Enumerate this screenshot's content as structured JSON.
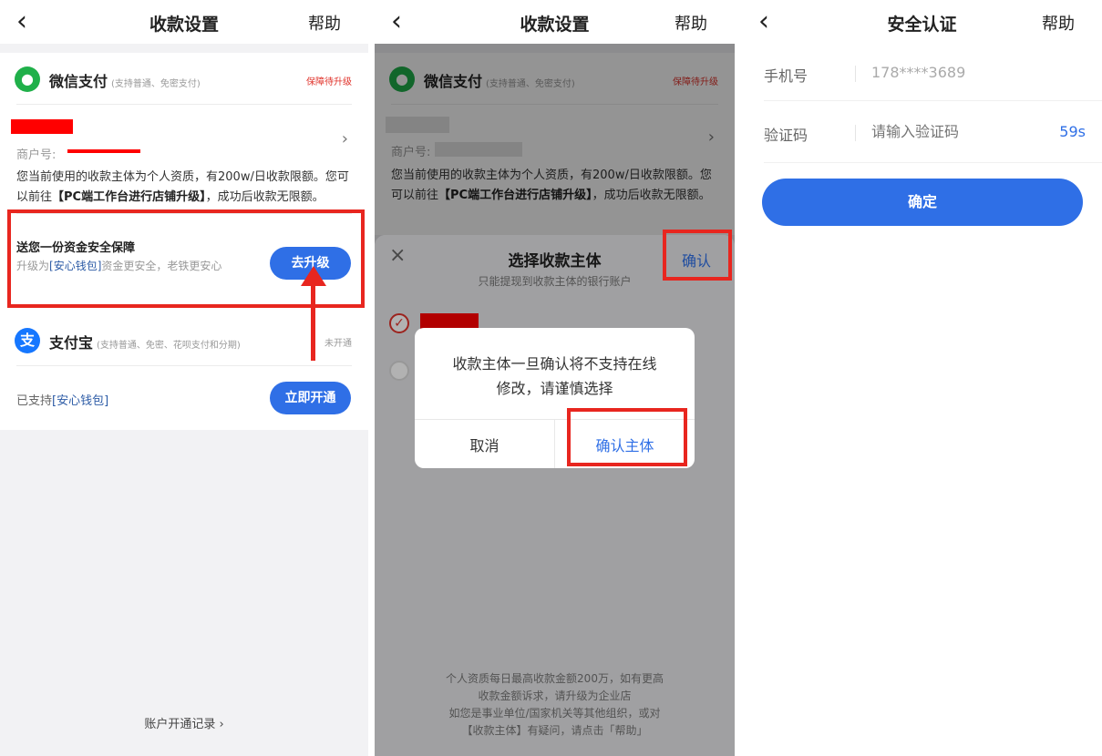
{
  "panel1": {
    "nav": {
      "back": "‹",
      "title": "收款设置",
      "help": "帮助"
    },
    "wechat": {
      "name": "微信支付",
      "sub": "(支持普通、免密支付)",
      "status": "保障待升级"
    },
    "merchant_label": "商户号:",
    "chevron": "›",
    "desc_part1": "您当前使用的收款主体为个人资质，有200w/日收款限额。您可以前往",
    "desc_bold": "【PC端工作台进行店铺升级】",
    "desc_part2": "，成功后收款无限额。",
    "promo": {
      "title": "送您一份资金安全保障",
      "sub_pre": "升级为",
      "sub_hl": "[安心钱包]",
      "sub_post": "资金更安全，老铁更安心",
      "button": "去升级"
    },
    "alipay": {
      "name": "支付宝",
      "sub": "(支持普通、免密、花呗支付和分期)",
      "status": "未开通"
    },
    "support_pre": "已支持",
    "support_hl": "[安心钱包]",
    "open_button": "立即开通",
    "footer_link": "账户开通记录 ›"
  },
  "panel2": {
    "nav": {
      "back": "‹",
      "title": "收款设置",
      "help": "帮助"
    },
    "wechat": {
      "name": "微信支付",
      "sub": "(支持普通、免密支付)",
      "status": "保障待升级"
    },
    "merchant_label": "商户号:",
    "chevron": "›",
    "desc_part1": "您当前使用的收款主体为个人资质，有200w/日收款限额。您可以前往",
    "desc_bold": "【PC端工作台进行店铺升级】",
    "desc_part2": "，成功后收款无限额。",
    "sheet": {
      "close": "×",
      "title": "选择收款主体",
      "subtitle": "只能提现到收款主体的银行账户",
      "confirm": "确认",
      "note_line1": "个人资质每日最高收款金额200万，如有更高",
      "note_line2": "收款金额诉求，请升级为企业店",
      "note_line3": "如您是事业单位/国家机关等其他组织，或对",
      "note_line4": "【收款主体】有疑问，请点击「帮助」"
    },
    "dialog": {
      "line1": "收款主体一旦确认将不支持在线",
      "line2": "修改，请谨慎选择",
      "cancel": "取消",
      "ok": "确认主体"
    }
  },
  "panel3": {
    "nav": {
      "back": "‹",
      "title": "安全认证",
      "help": "帮助"
    },
    "phone_label": "手机号",
    "phone_value": "178****3689",
    "code_label": "验证码",
    "code_placeholder": "请输入验证码",
    "countdown": "59s",
    "submit": "确定"
  },
  "colors": {
    "accent_blue": "#2f6fe6",
    "annotation_red": "#e8261f",
    "wechat_green": "#20b04a",
    "alipay_blue": "#1677ff"
  },
  "icons": {
    "back": "chevron-left-icon",
    "wechat": "wechat-logo-icon",
    "alipay": "alipay-logo-icon",
    "close": "close-icon",
    "check": "check-circle-icon"
  }
}
